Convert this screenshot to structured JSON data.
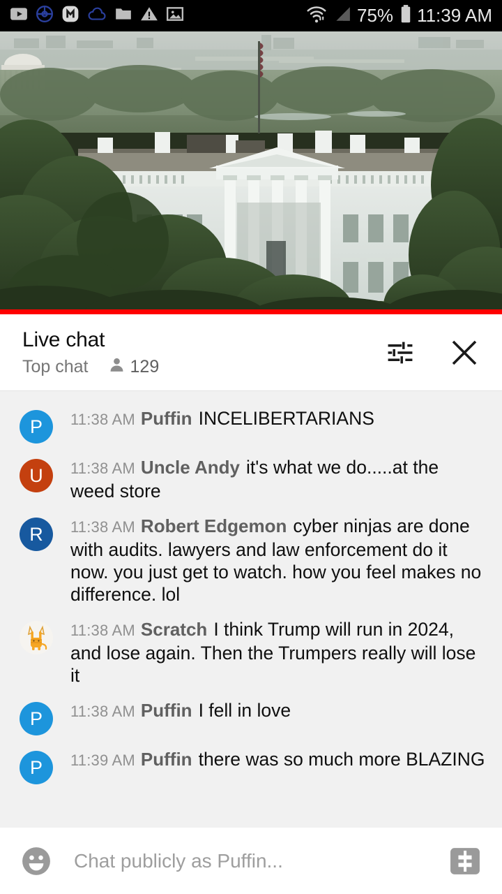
{
  "status_bar": {
    "icons": [
      {
        "name": "youtube-icon"
      },
      {
        "name": "pokemon-go-icon"
      },
      {
        "name": "messenger-icon"
      },
      {
        "name": "cloud-sync-icon"
      },
      {
        "name": "folder-icon"
      },
      {
        "name": "warning-icon"
      },
      {
        "name": "image-icon"
      }
    ],
    "wifi": "wifi-icon",
    "signal": "cell-signal-icon",
    "battery_percent": "75%",
    "battery": "battery-icon",
    "clock": "11:39 AM"
  },
  "player": {
    "name": "white-house-live-stream",
    "progress_percent": 100,
    "progress_color": "#ff0000"
  },
  "chat_header": {
    "title": "Live chat",
    "subtitle": "Top chat",
    "viewer_count": "129",
    "settings_label": "chat-settings",
    "close_label": "close-chat"
  },
  "messages": [
    {
      "avatar_letter": "P",
      "avatar_color": "#1d95dc",
      "avatar_type": "letter",
      "time": "11:38 AM",
      "author": "Puffin",
      "text": "INCELIBERTARIANS"
    },
    {
      "avatar_letter": "U",
      "avatar_color": "#c4400f",
      "avatar_type": "letter",
      "time": "11:38 AM",
      "author": "Uncle Andy",
      "text": "it's what we do.....at the weed store"
    },
    {
      "avatar_letter": "R",
      "avatar_color": "#17599f",
      "avatar_type": "letter",
      "time": "11:38 AM",
      "author": "Robert Edgemon",
      "text": "cyber ninjas are done with audits. lawyers and law enforcement do it now. you just get to watch. how you feel makes no difference. lol"
    },
    {
      "avatar_letter": "",
      "avatar_color": "#f5f3ef",
      "avatar_type": "cat-image",
      "time": "11:38 AM",
      "author": "Scratch",
      "text": "I think Trump will run in 2024, and lose again. Then the Trumpers really will lose it"
    },
    {
      "avatar_letter": "P",
      "avatar_color": "#1d95dc",
      "avatar_type": "letter",
      "time": "11:38 AM",
      "author": "Puffin",
      "text": "I fell in love"
    },
    {
      "avatar_letter": "P",
      "avatar_color": "#1d95dc",
      "avatar_type": "letter",
      "time": "11:39 AM",
      "author": "Puffin",
      "text": "there was so much more BLAZING"
    }
  ],
  "composer": {
    "emoji_label": "emoji-picker",
    "placeholder": "Chat publicly as Puffin...",
    "value": "",
    "superchat_label": "super-chat"
  }
}
